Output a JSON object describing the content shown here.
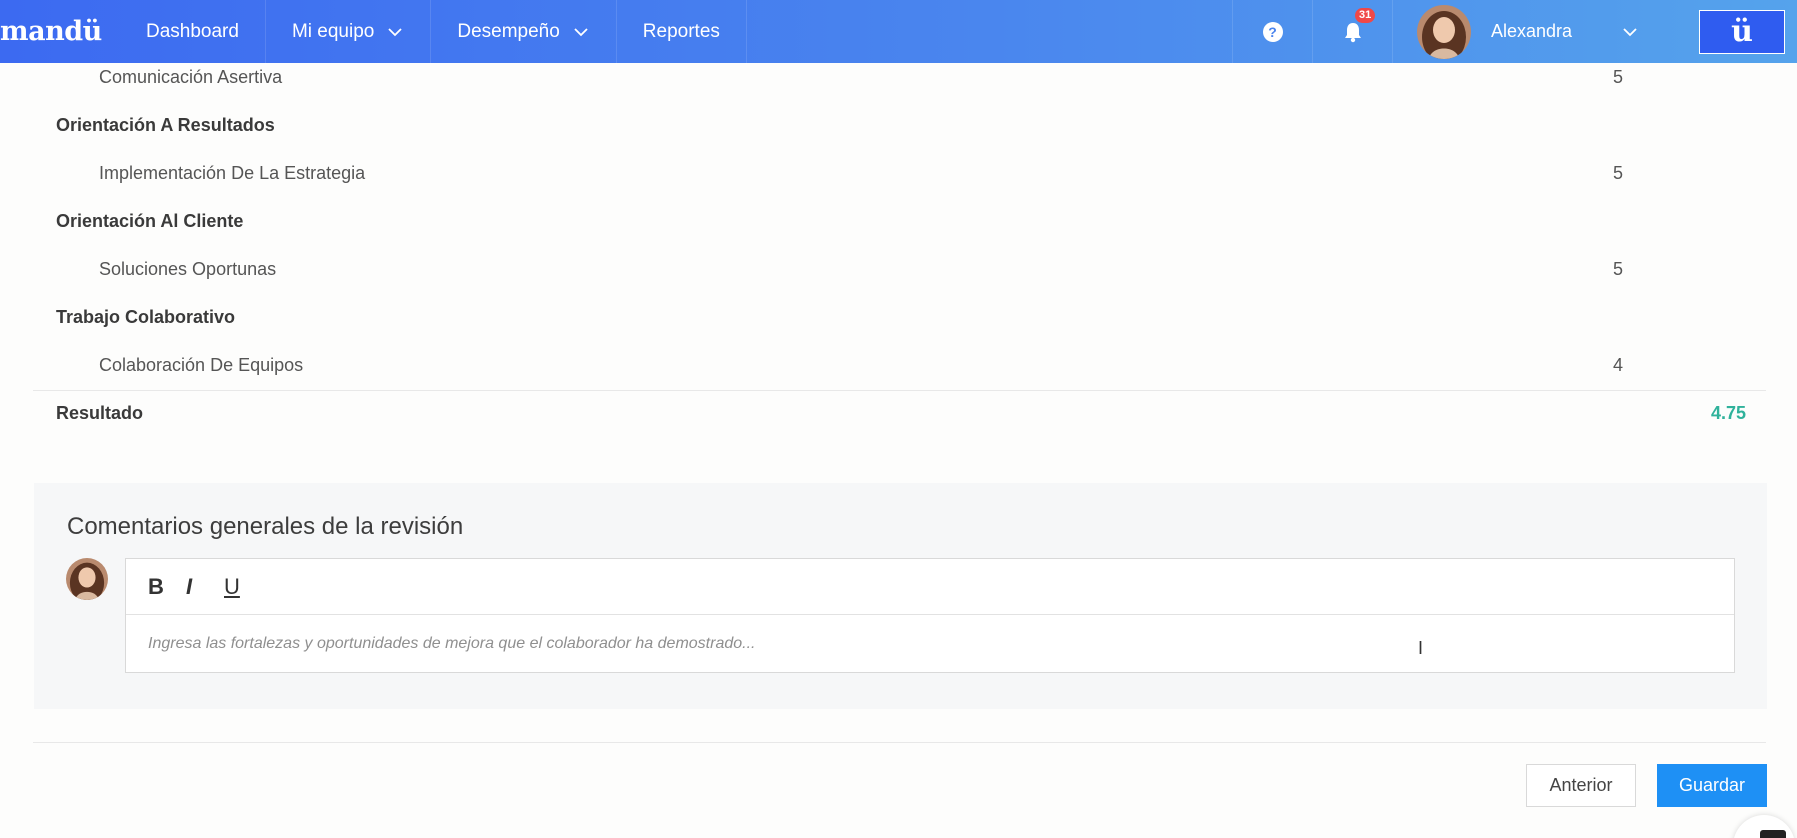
{
  "nav": {
    "brand": "mandü",
    "items": [
      {
        "label": "Dashboard"
      },
      {
        "label": "Mi equipo"
      },
      {
        "label": "Desempeño"
      },
      {
        "label": "Reportes"
      }
    ],
    "help_glyph": "?",
    "notifications_count": "31",
    "user_name": "Alexandra",
    "app_glyph": "ü"
  },
  "competencies": [
    {
      "type": "sub",
      "label": "Comunicación Asertiva",
      "score": "5"
    },
    {
      "type": "cat",
      "label": "Orientación A Resultados"
    },
    {
      "type": "sub",
      "label": "Implementación De La Estrategia",
      "score": "5"
    },
    {
      "type": "cat",
      "label": "Orientación Al Cliente"
    },
    {
      "type": "sub",
      "label": "Soluciones Oportunas",
      "score": "5"
    },
    {
      "type": "cat",
      "label": "Trabajo Colaborativo"
    },
    {
      "type": "sub",
      "label": "Colaboración De Equipos",
      "score": "4"
    }
  ],
  "result": {
    "label": "Resultado",
    "value": "4.75"
  },
  "comments": {
    "title": "Comentarios generales de la revisión",
    "toolbar": {
      "bold": "B",
      "italic": "I",
      "underline": "U"
    },
    "placeholder": "Ingresa las fortalezas y oportunidades de mejora que el colaborador ha demostrado..."
  },
  "footer": {
    "prev_label": "Anterior",
    "save_label": "Guardar"
  },
  "colors": {
    "accent": "#1e90f5",
    "result": "#2fb29b",
    "nav_start": "#3c6af1",
    "nav_end": "#55a3ec"
  }
}
